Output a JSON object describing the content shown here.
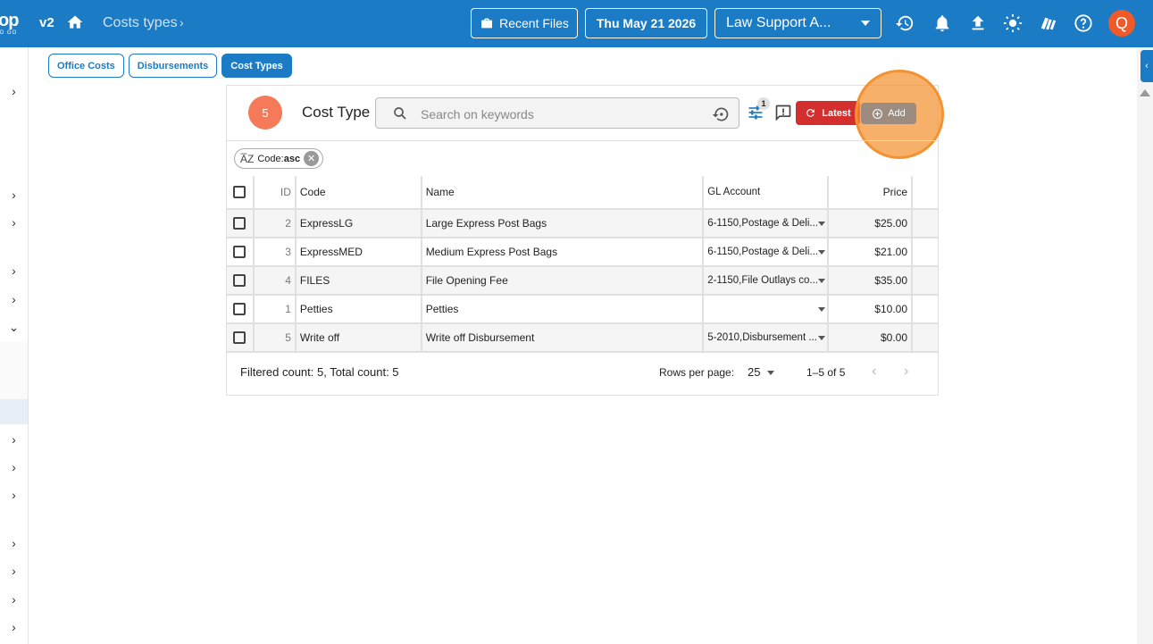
{
  "app": {
    "logo_big": "op",
    "logo_small": "D GO",
    "version": "v2",
    "breadcrumb": "Costs types",
    "recent_files": "Recent Files",
    "date": "Thu May 21 2026",
    "company": "Law Support A...",
    "avatar_letter": "Q"
  },
  "tabs": [
    {
      "label": "Office Costs",
      "active": false
    },
    {
      "label": "Disbursements",
      "active": false
    },
    {
      "label": "Cost Types",
      "active": true
    }
  ],
  "panel": {
    "count": "5",
    "title": "Cost Type",
    "search_placeholder": "Search on keywords",
    "filter_badge": "1",
    "latest_label": "Latest",
    "add_label": "Add",
    "sort_chip": "Code:",
    "sort_chip_dir": "asc"
  },
  "table": {
    "headers": {
      "id": "ID",
      "code": "Code",
      "name": "Name",
      "gl": "GL Account",
      "price": "Price"
    },
    "rows": [
      {
        "id": "2",
        "code": "ExpressLG",
        "name": "Large Express Post Bags",
        "gl": "6-1150,Postage & Deli...",
        "price": "$25.00"
      },
      {
        "id": "3",
        "code": "ExpressMED",
        "name": "Medium Express Post Bags",
        "gl": "6-1150,Postage & Deli...",
        "price": "$21.00"
      },
      {
        "id": "4",
        "code": "FILES",
        "name": "File Opening Fee",
        "gl": "2-1150,File Outlays co...",
        "price": "$35.00"
      },
      {
        "id": "1",
        "code": "Petties",
        "name": "Petties",
        "gl": "",
        "price": "$10.00"
      },
      {
        "id": "5",
        "code": "Write off",
        "name": "Write off Disbursement",
        "gl": "5-2010,Disbursement ...",
        "price": "$0.00"
      }
    ]
  },
  "footer": {
    "count_text": "Filtered count: 5, Total count: 5",
    "rows_per_page_label": "Rows per page:",
    "rows_per_page": "25",
    "range": "1–5 of 5"
  },
  "colors": {
    "primary": "#1b7bc4",
    "danger": "#d32f2f",
    "highlight": "#f49130",
    "badge": "#f47a5a"
  }
}
